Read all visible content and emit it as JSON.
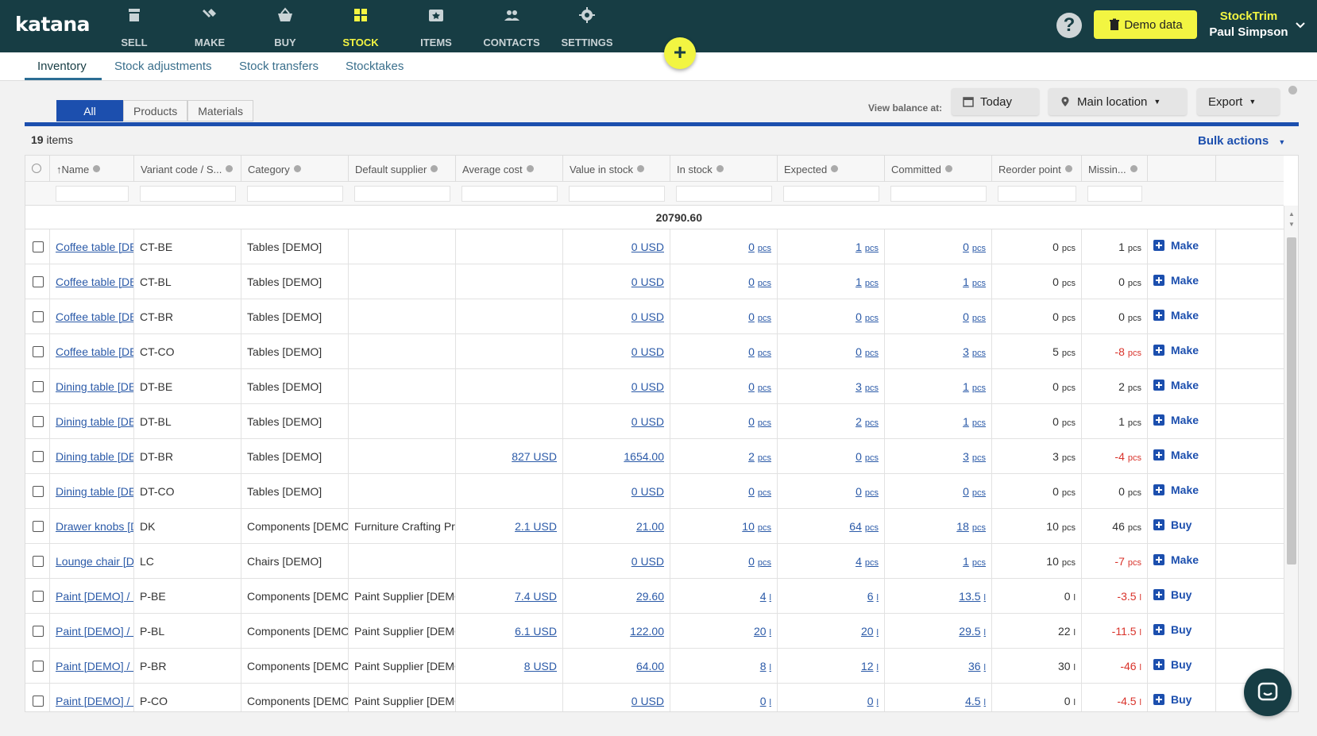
{
  "app": {
    "logo": "katana"
  },
  "nav": [
    {
      "label": "SELL",
      "icon": "shop-icon",
      "active": false
    },
    {
      "label": "MAKE",
      "icon": "tools-icon",
      "active": false
    },
    {
      "label": "BUY",
      "icon": "basket-icon",
      "active": false
    },
    {
      "label": "STOCK",
      "icon": "stock-icon",
      "active": true
    },
    {
      "label": "ITEMS",
      "icon": "items-icon",
      "active": false
    },
    {
      "label": "CONTACTS",
      "icon": "contacts-icon",
      "active": false
    },
    {
      "label": "SETTINGS",
      "icon": "gear-icon",
      "active": false
    }
  ],
  "header": {
    "help": "?",
    "demo_label": "Demo data",
    "org": "StockTrim",
    "user": "Paul Simpson",
    "fab": "+"
  },
  "subtabs": [
    {
      "label": "Inventory",
      "active": true
    },
    {
      "label": "Stock adjustments",
      "active": false
    },
    {
      "label": "Stock transfers",
      "active": false
    },
    {
      "label": "Stocktakes",
      "active": false
    }
  ],
  "filter_tabs": [
    "All",
    "Products",
    "Materials"
  ],
  "toolbar": {
    "view_balance": "View balance at:",
    "today": "Today",
    "location": "Main location",
    "export": "Export"
  },
  "list": {
    "count": "19",
    "count_suffix": " items",
    "bulk_actions": "Bulk actions",
    "total": "20790.60"
  },
  "columns": [
    "Name",
    "Variant code / S...",
    "Category",
    "Default supplier",
    "Average cost",
    "Value in stock",
    "In stock",
    "Expected",
    "Committed",
    "Reorder point",
    "Missin..."
  ],
  "rows": [
    {
      "name": "Coffee table [DEMO] / Beige",
      "code": "CT-BE",
      "category": "Tables [DEMO]",
      "supplier": "",
      "avg": "",
      "value": "0 USD",
      "in": "0",
      "exp": "1",
      "com": "0",
      "reorder": "0",
      "missing": "1",
      "unit": "pcs",
      "action": "Make"
    },
    {
      "name": "Coffee table [DEMO] / Blue",
      "code": "CT-BL",
      "category": "Tables [DEMO]",
      "supplier": "",
      "avg": "",
      "value": "0 USD",
      "in": "0",
      "exp": "1",
      "com": "1",
      "reorder": "0",
      "missing": "0",
      "unit": "pcs",
      "action": "Make"
    },
    {
      "name": "Coffee table [DEMO] / Brown",
      "code": "CT-BR",
      "category": "Tables [DEMO]",
      "supplier": "",
      "avg": "",
      "value": "0 USD",
      "in": "0",
      "exp": "0",
      "com": "0",
      "reorder": "0",
      "missing": "0",
      "unit": "pcs",
      "action": "Make"
    },
    {
      "name": "Coffee table [DEMO] / Coral",
      "code": "CT-CO",
      "category": "Tables [DEMO]",
      "supplier": "",
      "avg": "",
      "value": "0 USD",
      "in": "0",
      "exp": "0",
      "com": "3",
      "reorder": "5",
      "missing": "-8",
      "unit": "pcs",
      "action": "Make"
    },
    {
      "name": "Dining table [DEMO] / Beige",
      "code": "DT-BE",
      "category": "Tables [DEMO]",
      "supplier": "",
      "avg": "",
      "value": "0 USD",
      "in": "0",
      "exp": "3",
      "com": "1",
      "reorder": "0",
      "missing": "2",
      "unit": "pcs",
      "action": "Make"
    },
    {
      "name": "Dining table [DEMO] / Blue",
      "code": "DT-BL",
      "category": "Tables [DEMO]",
      "supplier": "",
      "avg": "",
      "value": "0 USD",
      "in": "0",
      "exp": "2",
      "com": "1",
      "reorder": "0",
      "missing": "1",
      "unit": "pcs",
      "action": "Make"
    },
    {
      "name": "Dining table [DEMO] / Brown",
      "code": "DT-BR",
      "category": "Tables [DEMO]",
      "supplier": "",
      "avg": "827 USD",
      "value": "1654.00",
      "in": "2",
      "exp": "0",
      "com": "3",
      "reorder": "3",
      "missing": "-4",
      "unit": "pcs",
      "action": "Make"
    },
    {
      "name": "Dining table [DEMO] / Coral",
      "code": "DT-CO",
      "category": "Tables [DEMO]",
      "supplier": "",
      "avg": "",
      "value": "0 USD",
      "in": "0",
      "exp": "0",
      "com": "0",
      "reorder": "0",
      "missing": "0",
      "unit": "pcs",
      "action": "Make"
    },
    {
      "name": "Drawer knobs [DEMO]",
      "code": "DK",
      "category": "Components [DEMO]",
      "supplier": "Furniture Crafting Pro",
      "avg": "2.1 USD",
      "value": "21.00",
      "in": "10",
      "exp": "64",
      "com": "18",
      "reorder": "10",
      "missing": "46",
      "unit": "pcs",
      "action": "Buy"
    },
    {
      "name": "Lounge chair [DEMO]",
      "code": "LC",
      "category": "Chairs [DEMO]",
      "supplier": "",
      "avg": "",
      "value": "0 USD",
      "in": "0",
      "exp": "4",
      "com": "1",
      "reorder": "10",
      "missing": "-7",
      "unit": "pcs",
      "action": "Make"
    },
    {
      "name": "Paint [DEMO] / Beige",
      "code": "P-BE",
      "category": "Components [DEMO]",
      "supplier": "Paint Supplier [DEMO]",
      "avg": "7.4 USD",
      "value": "29.60",
      "in": "4",
      "exp": "6",
      "com": "13.5",
      "reorder": "0",
      "missing": "-3.5",
      "unit": "l",
      "action": "Buy"
    },
    {
      "name": "Paint [DEMO] / Blue",
      "code": "P-BL",
      "category": "Components [DEMO]",
      "supplier": "Paint Supplier [DEMO]",
      "avg": "6.1 USD",
      "value": "122.00",
      "in": "20",
      "exp": "20",
      "com": "29.5",
      "reorder": "22",
      "missing": "-11.5",
      "unit": "l",
      "action": "Buy"
    },
    {
      "name": "Paint [DEMO] / Brown",
      "code": "P-BR",
      "category": "Components [DEMO]",
      "supplier": "Paint Supplier [DEMO]",
      "avg": "8 USD",
      "value": "64.00",
      "in": "8",
      "exp": "12",
      "com": "36",
      "reorder": "30",
      "missing": "-46",
      "unit": "l",
      "action": "Buy"
    },
    {
      "name": "Paint [DEMO] / Coral",
      "code": "P-CO",
      "category": "Components [DEMO]",
      "supplier": "Paint Supplier [DEMO]",
      "avg": "",
      "value": "0 USD",
      "in": "0",
      "exp": "0",
      "com": "4.5",
      "reorder": "0",
      "missing": "-4.5",
      "unit": "l",
      "action": "Buy"
    }
  ]
}
